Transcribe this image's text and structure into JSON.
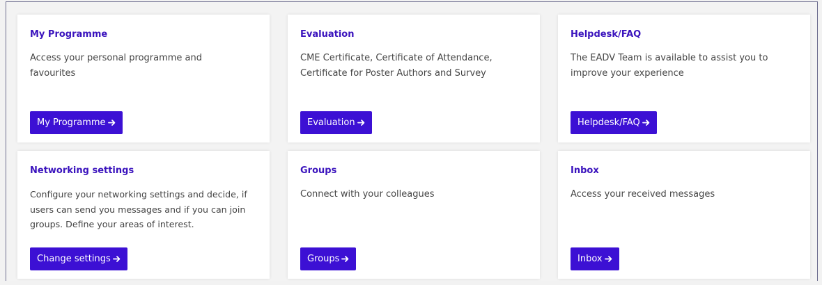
{
  "cards": [
    {
      "title": "My Programme",
      "description": "Access your personal programme and favourites",
      "button_label": "My Programme"
    },
    {
      "title": "Evaluation",
      "description": "CME Certificate, Certificate of Attendance, Certificate for Poster Authors and Survey",
      "button_label": "Evaluation"
    },
    {
      "title": "Helpdesk/FAQ",
      "description": "The EADV Team is available to assist you to improve your experience",
      "button_label": "Helpdesk/FAQ"
    },
    {
      "title": "Networking settings",
      "description": "Configure your networking settings and decide, if users can send you messages and if you can join groups. Define your areas of interest.",
      "button_label": "Change settings"
    },
    {
      "title": "Groups",
      "description": "Connect with your colleagues",
      "button_label": "Groups"
    },
    {
      "title": "Inbox",
      "description": "Access your received messages",
      "button_label": "Inbox"
    }
  ],
  "colors": {
    "accent": "#3c10d4",
    "title": "#3a13bd",
    "text": "#444444",
    "background": "#f3f3f3"
  }
}
